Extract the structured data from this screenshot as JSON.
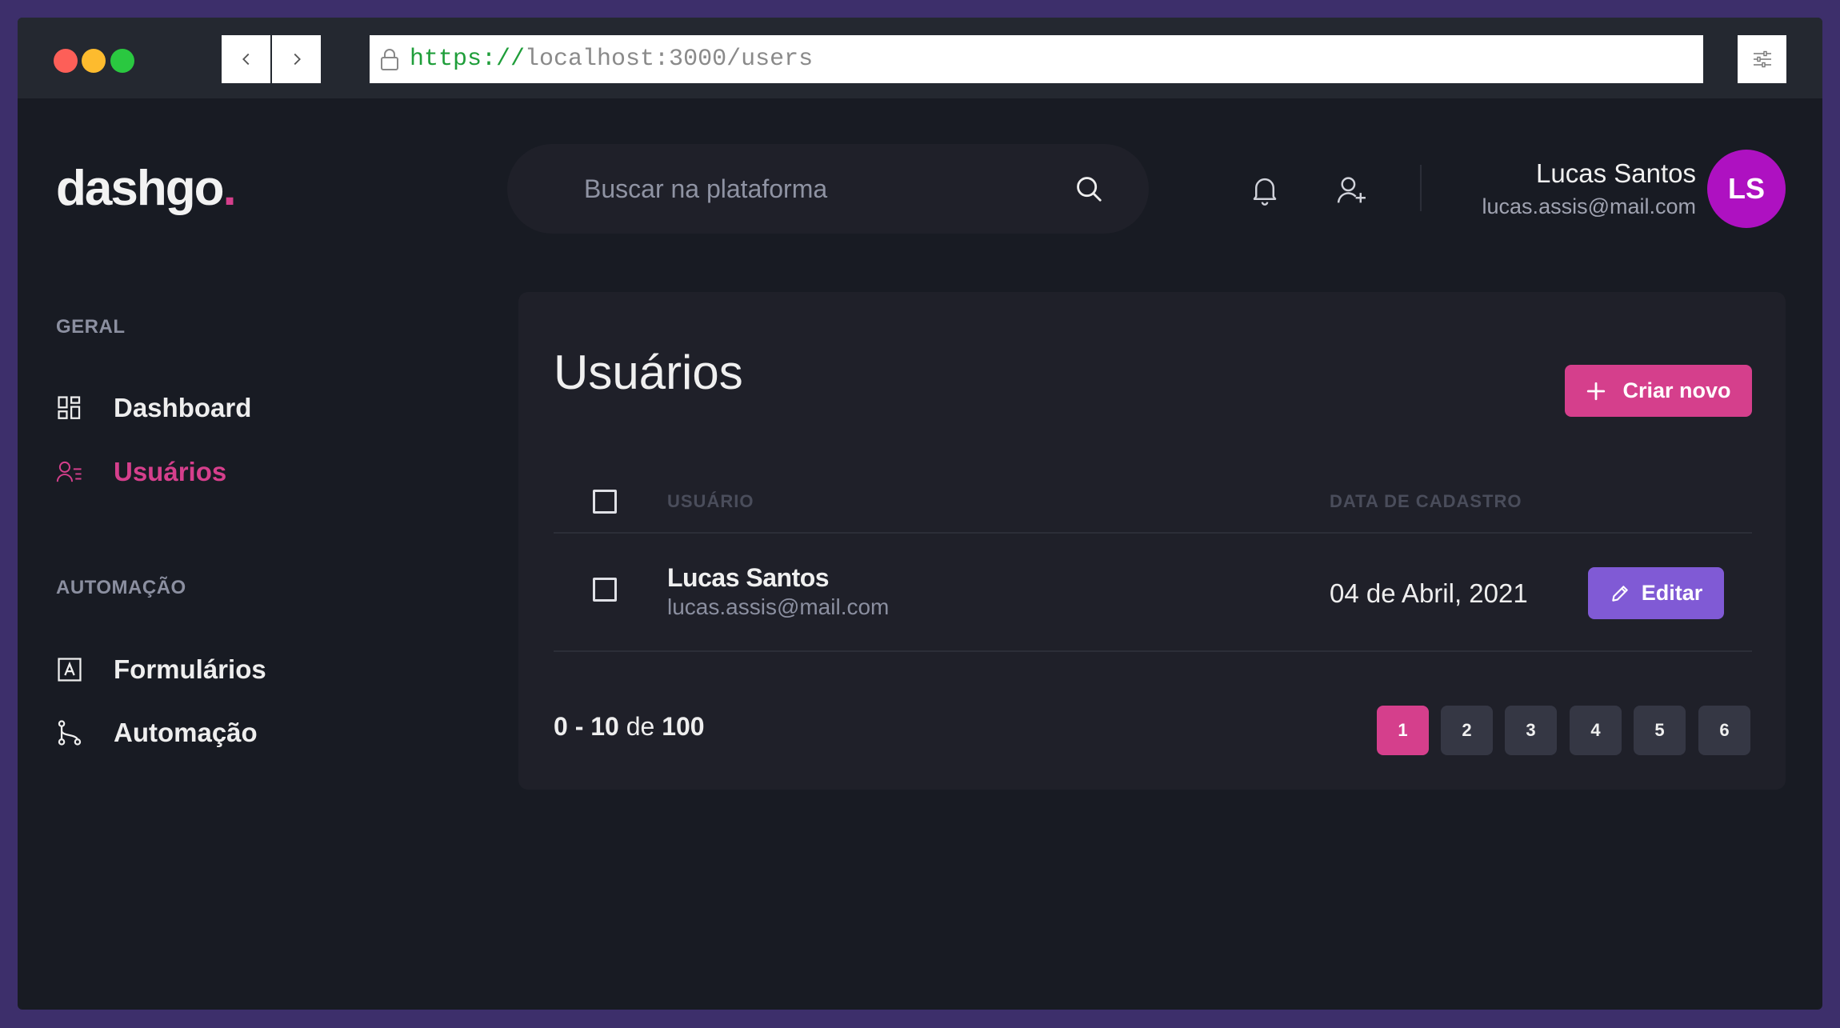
{
  "browser": {
    "url_scheme": "https://",
    "url_rest": "localhost:3000/users"
  },
  "app": {
    "logo_text": "dashgo",
    "logo_dot": "."
  },
  "search": {
    "placeholder": "Buscar na plataforma"
  },
  "header": {
    "user_name": "Lucas Santos",
    "user_email": "lucas.assis@mail.com",
    "avatar_initials": "LS"
  },
  "sidebar": {
    "sections": [
      {
        "title": "GERAL",
        "items": [
          {
            "label": "Dashboard",
            "icon": "dashboard-icon",
            "active": false
          },
          {
            "label": "Usuários",
            "icon": "users-icon",
            "active": true
          }
        ]
      },
      {
        "title": "AUTOMAÇÃO",
        "items": [
          {
            "label": "Formulários",
            "icon": "forms-icon",
            "active": false
          },
          {
            "label": "Automação",
            "icon": "automation-icon",
            "active": false
          }
        ]
      }
    ]
  },
  "main": {
    "title": "Usuários",
    "create_label": "Criar novo",
    "table": {
      "headers": [
        "USUÁRIO",
        "DATA DE CADASTRO"
      ],
      "rows": [
        {
          "name": "Lucas Santos",
          "email": "lucas.assis@mail.com",
          "date": "04 de Abril, 2021",
          "action": "Editar"
        }
      ]
    },
    "pagination": {
      "range": "0 - 10",
      "of": "de",
      "total": "100",
      "pages": [
        "1",
        "2",
        "3",
        "4",
        "5",
        "6"
      ],
      "current": "1"
    }
  },
  "colors": {
    "accent_pink": "#d53f8c",
    "accent_purple": "#805ad5",
    "avatar": "#ae11c1",
    "background": "#181b23",
    "panel": "#1f2029"
  }
}
